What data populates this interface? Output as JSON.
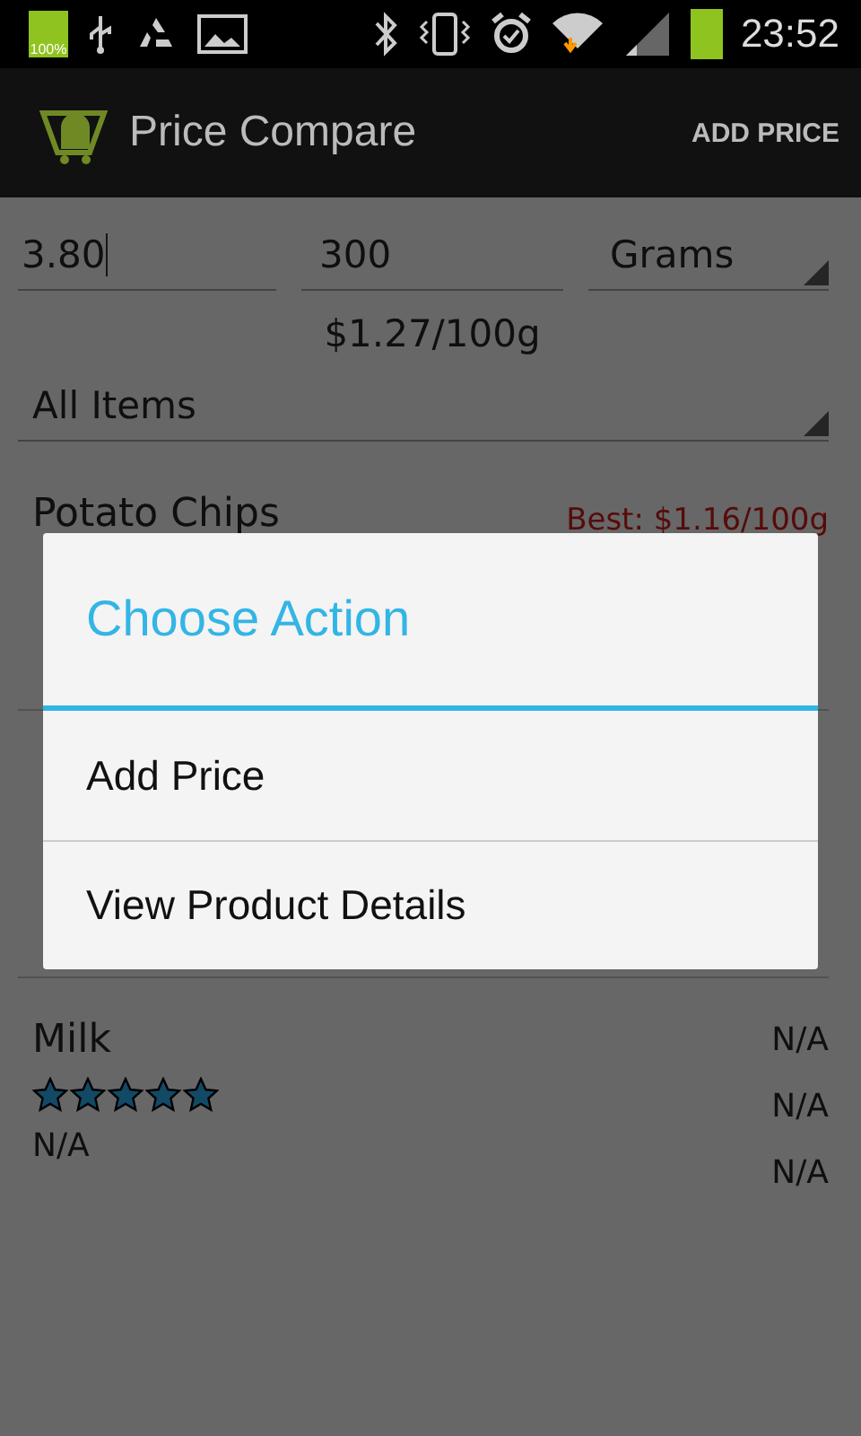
{
  "status_bar": {
    "battery_label": "100%",
    "time": "23:52"
  },
  "action_bar": {
    "title": "Price Compare",
    "action": "ADD PRICE"
  },
  "form": {
    "price": "3.80",
    "quantity": "300",
    "unit": "Grams",
    "unit_price": "$1.27/100g"
  },
  "filter": {
    "value": "All Items"
  },
  "products": [
    {
      "name": "Potato Chips",
      "best": "Best: $1.16/100g"
    },
    {
      "kind": "hidden"
    },
    {
      "name": "Milk",
      "stars": 5,
      "rating": "N/A",
      "values": [
        "N/A",
        "N/A",
        "N/A"
      ]
    }
  ],
  "dialog": {
    "title": "Choose Action",
    "items": [
      "Add Price",
      "View Product Details"
    ]
  }
}
